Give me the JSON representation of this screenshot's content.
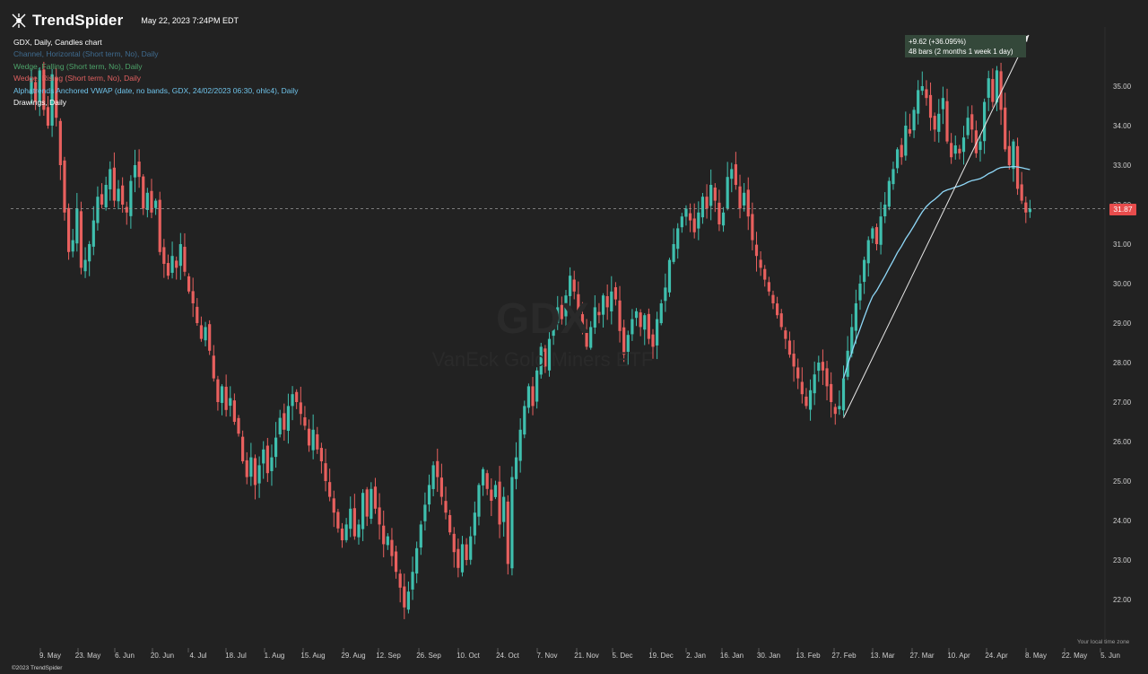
{
  "app": {
    "brand": "TrendSpider",
    "timestamp": "May 22, 2023 7:24PM EDT",
    "copyright": "©2023 TrendSpider"
  },
  "legend": [
    {
      "text": "GDX, Daily, Candles chart",
      "color": "#ffffff"
    },
    {
      "text": "Channel, Horizontal (Short term, No), Daily",
      "color": "#3f6b8f"
    },
    {
      "text": "Wedge, Falling (Short term, No), Daily",
      "color": "#4da46a"
    },
    {
      "text": "Wedge, Rising (Short term, No), Daily",
      "color": "#e06060"
    },
    {
      "text": "Alphatrends Anchored VWAP (date, no bands, GDX, 24/02/2023 06:30, ohlc4), Daily",
      "color": "#6fc3ea"
    },
    {
      "text": "Drawings, Daily",
      "color": "#ffffff"
    }
  ],
  "watermark": {
    "symbol": "GDX",
    "name": "VanEck Gold Miners ETF"
  },
  "last_price_label": "31.87",
  "timezone_note": "Your local time zone",
  "annotation": {
    "line1": "+9.62 (+36.095%)",
    "line2": "48 bars (2 months 1 week 1 day)"
  },
  "colors": {
    "up": "#3fbfae",
    "down": "#e8605e",
    "vwap": "#8fd8f8",
    "background": "#222222",
    "badge": "#e84c4c"
  },
  "chart_data": {
    "type": "candlestick",
    "ylim": [
      21,
      36.5
    ],
    "y_ticks": [
      "22.00",
      "23.00",
      "24.00",
      "25.00",
      "26.00",
      "27.00",
      "28.00",
      "29.00",
      "30.00",
      "31.00",
      "32.00",
      "33.00",
      "34.00",
      "35.00"
    ],
    "x_ticks": [
      "9. May",
      "23. May",
      "6. Jun",
      "20. Jun",
      "4. Jul",
      "18. Jul",
      "1. Aug",
      "15. Aug",
      "29. Aug",
      "12. Sep",
      "26. Sep",
      "10. Oct",
      "24. Oct",
      "7. Nov",
      "21. Nov",
      "5. Dec",
      "19. Dec",
      "2. Jan",
      "16. Jan",
      "30. Jan",
      "13. Feb",
      "27. Feb",
      "13. Mar",
      "27. Mar",
      "10. Apr",
      "24. Apr",
      "8. May",
      "22. May",
      "5. Jun"
    ],
    "closes": [
      35.2,
      34.6,
      35.4,
      34.4,
      34.0,
      35.3,
      34.2,
      33.0,
      31.8,
      30.8,
      31.1,
      31.9,
      30.4,
      30.6,
      31.0,
      31.6,
      32.2,
      32.0,
      32.5,
      32.9,
      32.1,
      32.4,
      32.0,
      31.8,
      32.6,
      33.0,
      32.7,
      31.9,
      32.3,
      31.8,
      32.1,
      30.8,
      30.5,
      30.2,
      30.7,
      30.4,
      31.0,
      30.3,
      29.8,
      29.5,
      29.0,
      28.6,
      28.9,
      28.3,
      27.6,
      27.0,
      27.4,
      26.8,
      27.1,
      26.5,
      26.2,
      25.5,
      25.1,
      25.6,
      24.9,
      25.4,
      25.8,
      25.2,
      25.6,
      26.1,
      26.6,
      26.3,
      26.9,
      27.2,
      27.0,
      26.7,
      26.4,
      25.9,
      26.3,
      25.8,
      25.5,
      25.0,
      24.6,
      24.2,
      23.8,
      23.5,
      23.9,
      24.3,
      23.6,
      23.9,
      24.7,
      24.1,
      24.8,
      24.3,
      23.9,
      23.4,
      23.6,
      23.1,
      22.7,
      22.3,
      21.8,
      22.2,
      22.7,
      23.3,
      23.9,
      24.4,
      24.9,
      25.4,
      25.1,
      24.6,
      24.2,
      23.7,
      23.2,
      22.8,
      23.4,
      23.0,
      23.6,
      24.2,
      24.9,
      25.3,
      24.8,
      24.5,
      24.9,
      23.9,
      24.6,
      22.9,
      25.1,
      25.6,
      26.3,
      26.9,
      27.4,
      26.9,
      27.8,
      28.4,
      27.9,
      28.6,
      28.9,
      29.4,
      29.1,
      29.7,
      30.2,
      29.8,
      29.3,
      28.8,
      28.4,
      28.9,
      29.4,
      29.2,
      29.7,
      29.4,
      29.8,
      29.6,
      28.8,
      28.2,
      28.7,
      29.1,
      29.3,
      28.9,
      29.2,
      28.6,
      28.4,
      29.1,
      29.5,
      29.9,
      30.6,
      31.0,
      31.4,
      31.7,
      31.9,
      31.6,
      31.3,
      31.8,
      32.2,
      31.9,
      32.5,
      32.1,
      31.5,
      31.8,
      32.7,
      32.9,
      32.5,
      31.9,
      32.3,
      31.7,
      31.1,
      30.7,
      30.4,
      30.1,
      29.8,
      29.5,
      29.2,
      28.9,
      28.6,
      28.2,
      27.9,
      27.6,
      27.2,
      26.9,
      27.3,
      27.7,
      28.0,
      27.8,
      27.4,
      27.0,
      26.7,
      26.9,
      27.6,
      28.3,
      28.9,
      29.5,
      30.0,
      30.6,
      31.1,
      31.4,
      31.0,
      31.7,
      32.0,
      32.6,
      32.9,
      33.4,
      33.2,
      34.0,
      33.8,
      34.4,
      34.9,
      35.0,
      34.7,
      34.2,
      33.9,
      34.3,
      34.7,
      33.6,
      33.2,
      33.5,
      33.3,
      33.7,
      34.2,
      33.9,
      33.3,
      33.6,
      34.6,
      35.2,
      34.6,
      35.4,
      34.4,
      33.4,
      33.0,
      33.6,
      32.4,
      32.1,
      31.8,
      31.9
    ]
  }
}
